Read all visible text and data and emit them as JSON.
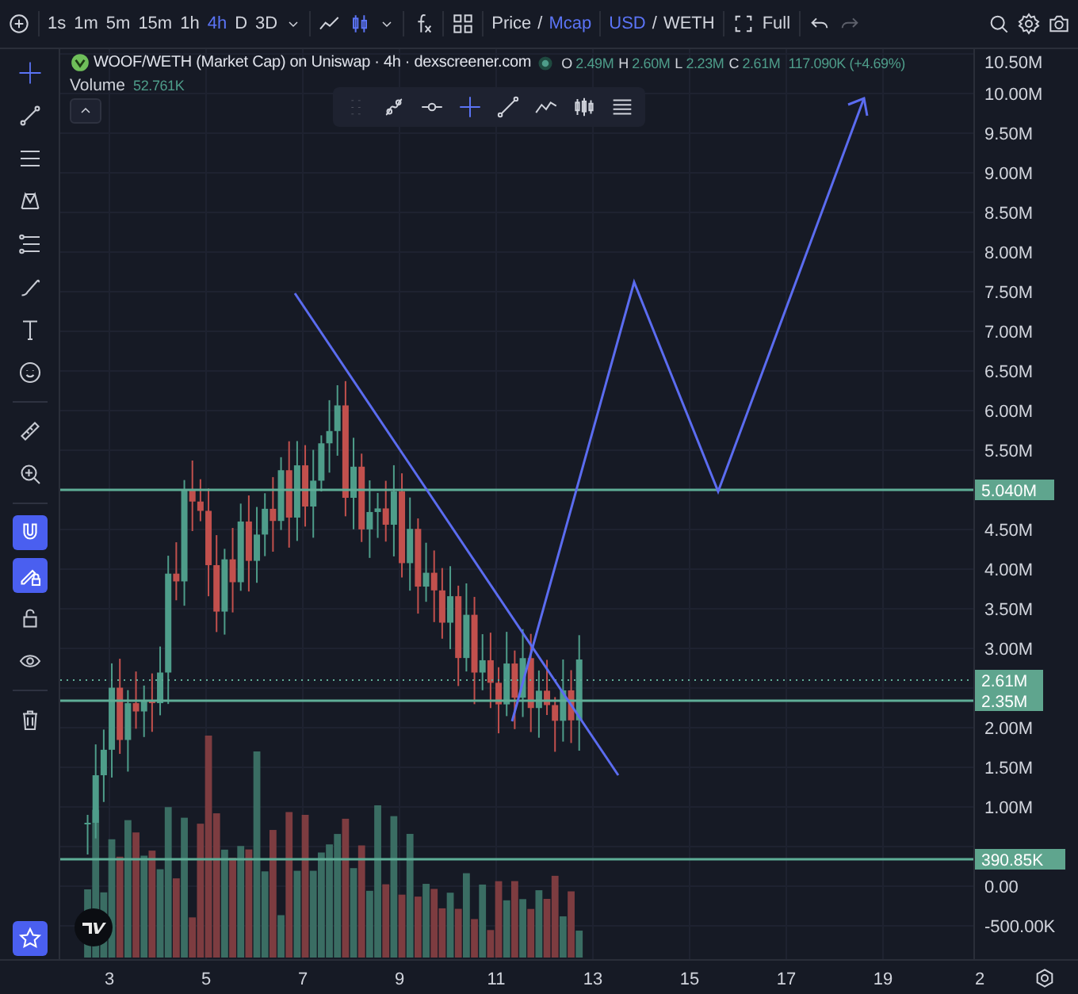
{
  "toolbar": {
    "intervals": [
      {
        "label": "1s",
        "selected": false
      },
      {
        "label": "1m",
        "selected": false
      },
      {
        "label": "5m",
        "selected": false
      },
      {
        "label": "15m",
        "selected": false
      },
      {
        "label": "1h",
        "selected": false
      },
      {
        "label": "4h",
        "selected": true
      },
      {
        "label": "D",
        "selected": false
      },
      {
        "label": "3D",
        "selected": false
      }
    ],
    "price_mode": [
      {
        "label": "Price",
        "selected": false
      },
      {
        "label": "Mcap",
        "selected": true
      }
    ],
    "price_mode_separator": "/",
    "currency": [
      {
        "label": "USD",
        "selected": true
      },
      {
        "label": "WETH",
        "selected": false
      }
    ],
    "currency_separator": "/",
    "fullscreen_label": "Full"
  },
  "legend": {
    "title": "WOOF/WETH (Market Cap) on Uniswap · 4h · dexscreener.com",
    "ohlc": [
      {
        "key": "O",
        "value": "2.49M"
      },
      {
        "key": "H",
        "value": "2.60M"
      },
      {
        "key": "L",
        "value": "2.23M"
      },
      {
        "key": "C",
        "value": "2.61M"
      }
    ],
    "change": "117.090K (+4.69%)",
    "volume_label": "Volume",
    "volume_value": "52.761K"
  },
  "left_tools": [
    [
      {
        "kind": "crosshair",
        "active": true
      },
      {
        "kind": "line",
        "active": false
      },
      {
        "kind": "hlines",
        "active": false
      },
      {
        "kind": "pattern",
        "active": false
      },
      {
        "kind": "fib",
        "active": false
      },
      {
        "kind": "brush",
        "active": false
      },
      {
        "kind": "text",
        "active": false
      },
      {
        "kind": "smiley",
        "active": false
      }
    ],
    [
      {
        "kind": "ruler",
        "active": false
      },
      {
        "kind": "zoom",
        "active": false
      }
    ],
    [
      {
        "kind": "magnet",
        "active": true
      },
      {
        "kind": "pencil-lock",
        "active": true
      },
      {
        "kind": "lock",
        "active": false
      },
      {
        "kind": "eye",
        "active": false
      }
    ],
    [
      {
        "kind": "trash",
        "active": false
      }
    ]
  ],
  "favorite_active": true,
  "price_axis": [
    "10.50M",
    "10.00M",
    "9.50M",
    "9.00M",
    "8.50M",
    "8.00M",
    "7.50M",
    "7.00M",
    "6.50M",
    "6.00M",
    "5.50M",
    "4.50M",
    "4.00M",
    "3.50M",
    "3.00M",
    "2.00M",
    "1.50M",
    "1.00M",
    "0.00",
    "-500.00K"
  ],
  "price_labels": [
    {
      "value": "5.040M",
      "kind": "line"
    },
    {
      "value": "2.61M",
      "kind": "last"
    },
    {
      "value": "2.35M",
      "kind": "line"
    },
    {
      "value": "390.85K",
      "kind": "line"
    }
  ],
  "time_axis": [
    "3",
    "5",
    "7",
    "9",
    "11",
    "13",
    "15",
    "17",
    "19",
    "2"
  ]
}
